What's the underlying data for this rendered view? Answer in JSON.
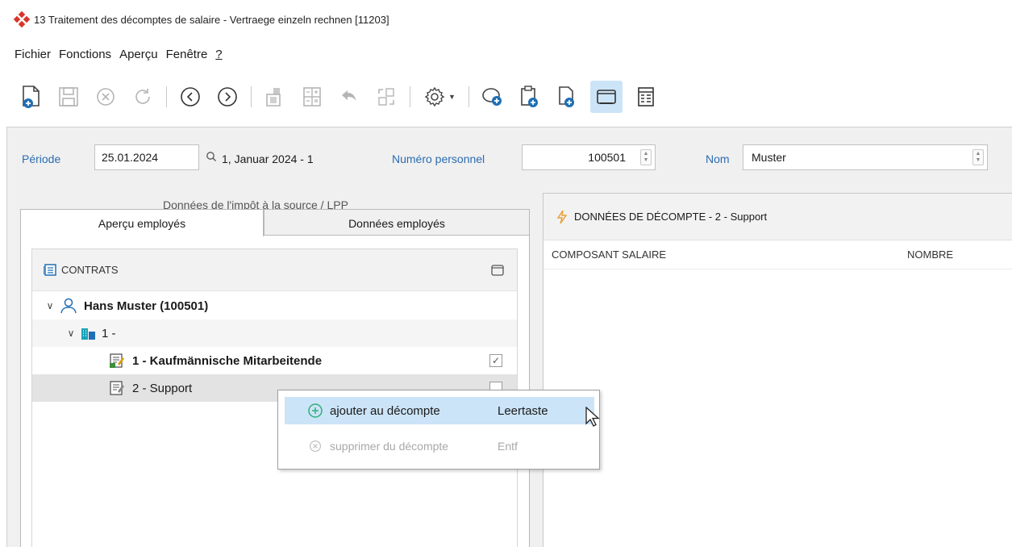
{
  "window": {
    "title": "13 Traitement des décomptes de salaire - Vertraege einzeln rechnen [11203]"
  },
  "menu": {
    "items": [
      "Fichier",
      "Fonctions",
      "Aperçu",
      "Fenêtre",
      "?"
    ]
  },
  "toolbar": {
    "buttons": [
      {
        "icon": "new-document-icon",
        "state": "enabled"
      },
      {
        "icon": "save-icon",
        "state": "disabled"
      },
      {
        "icon": "cancel-icon",
        "state": "disabled"
      },
      {
        "icon": "refresh-icon",
        "state": "disabled"
      },
      {
        "icon": "previous-icon",
        "state": "enabled"
      },
      {
        "icon": "next-icon",
        "state": "enabled"
      },
      {
        "icon": "copy-icon",
        "state": "disabled"
      },
      {
        "icon": "calculator-icon",
        "state": "disabled"
      },
      {
        "icon": "undo-icon",
        "state": "disabled"
      },
      {
        "icon": "expand-icon",
        "state": "disabled"
      },
      {
        "icon": "settings-icon",
        "state": "enabled"
      },
      {
        "icon": "add-comment-icon",
        "state": "enabled"
      },
      {
        "icon": "clipboard-add-icon",
        "state": "enabled"
      },
      {
        "icon": "document-add-icon",
        "state": "enabled"
      },
      {
        "icon": "window-icon",
        "state": "active"
      },
      {
        "icon": "form-icon",
        "state": "enabled"
      }
    ]
  },
  "filter": {
    "periode_label": "Période",
    "periode_value": "25.01.2024",
    "periode_text": "1, Januar 2024 - 1",
    "numero_label": "Numéro personnel",
    "numero_value": "100501",
    "nom_label": "Nom",
    "nom_value": "Muster"
  },
  "tabs": {
    "top_label": "Données de l'impôt à la source / LPP",
    "tab1": "Aperçu employés",
    "tab2": "Données employés"
  },
  "contracts": {
    "header": "CONTRATS",
    "employee": "Hans Muster (100501)",
    "company": "1 -",
    "contract1": "1 - Kaufmännische Mitarbeitende",
    "contract2": "2 - Support"
  },
  "right_panel": {
    "header": "DONNÉES DE DÉCOMPTE - 2 - Support",
    "col1": "COMPOSANT SALAIRE",
    "col2": "NOMBRE"
  },
  "context_menu": {
    "add_label": "ajouter au décompte",
    "add_shortcut": "Leertaste",
    "remove_label": "supprimer du décompte",
    "remove_shortcut": "Entf"
  },
  "colors": {
    "accent_blue": "#2b6cb0",
    "hover_blue": "#cce4f7",
    "icon_blue": "#1f6fb5",
    "icon_teal": "#1aa3b8"
  }
}
